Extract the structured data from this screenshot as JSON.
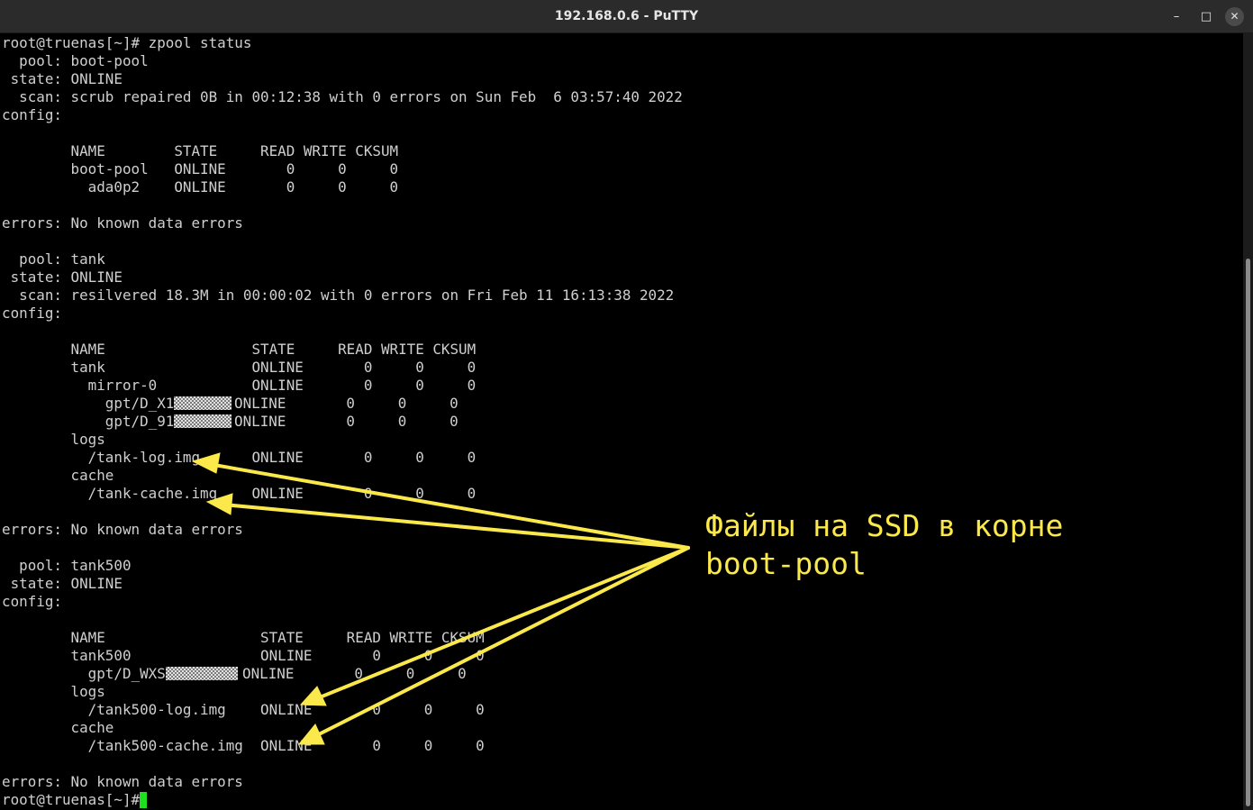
{
  "window": {
    "title": "192.168.0.6 - PuTTY",
    "min_icon": "–",
    "max_icon": "□",
    "close_icon": "✕"
  },
  "terminal": {
    "lines": [
      "root@truenas[~]# zpool status",
      "  pool: boot-pool",
      " state: ONLINE",
      "  scan: scrub repaired 0B in 00:12:38 with 0 errors on Sun Feb  6 03:57:40 2022",
      "config:",
      "",
      "        NAME        STATE     READ WRITE CKSUM",
      "        boot-pool   ONLINE       0     0     0",
      "          ada0p2    ONLINE       0     0     0",
      "",
      "errors: No known data errors",
      "",
      "  pool: tank",
      " state: ONLINE",
      "  scan: resilvered 18.3M in 00:00:02 with 0 errors on Fri Feb 11 16:13:38 2022",
      "config:",
      "",
      "        NAME                 STATE     READ WRITE CKSUM",
      "        tank                 ONLINE       0     0     0",
      "          mirror-0           ONLINE       0     0     0",
      "            gpt/D_X1",
      "            gpt/D_91",
      "        logs",
      "          /tank-log.img      ONLINE       0     0     0",
      "        cache",
      "          /tank-cache.img    ONLINE       0     0     0",
      "",
      "errors: No known data errors",
      "",
      "  pool: tank500",
      " state: ONLINE",
      "config:",
      "",
      "        NAME                  STATE     READ WRITE CKSUM",
      "        tank500               ONLINE       0     0     0",
      "          gpt/D_WXS",
      "        logs",
      "          /tank500-log.img    ONLINE       0     0     0",
      "        cache",
      "          /tank500-cache.img  ONLINE       0     0     0",
      "",
      "errors: No known data errors",
      "root@truenas[~]# "
    ],
    "masked_tails": {
      "20": "ONLINE       0     0     0",
      "21": "ONLINE       0     0     0",
      "35": "ONLINE       0     0     0"
    }
  },
  "annotation": {
    "line1": "Файлы на SSD в корне",
    "line2": "boot-pool",
    "color": "#fbe84b"
  },
  "colors": {
    "terminal_bg": "#000000",
    "terminal_fg": "#cfcfcf",
    "cursor": "#1ee01e",
    "titlebar": "#2b2b2b"
  }
}
